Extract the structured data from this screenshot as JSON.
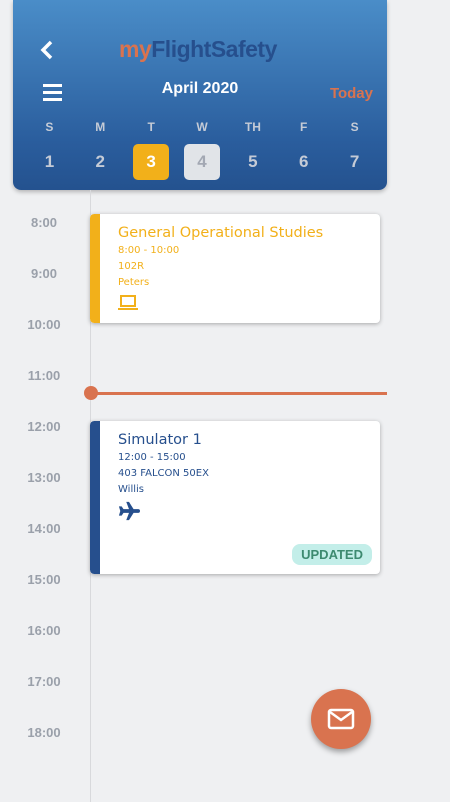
{
  "header": {
    "logo_my": "my",
    "logo_brand": "FlightSafety",
    "month": "April 2020",
    "today_label": "Today",
    "weekdays": [
      "S",
      "M",
      "T",
      "W",
      "TH",
      "F",
      "S"
    ],
    "days": [
      "1",
      "2",
      "3",
      "4",
      "5",
      "6",
      "7"
    ],
    "selected_day": "3"
  },
  "hours": [
    "8:00",
    "9:00",
    "10:00",
    "11:00",
    "12:00",
    "13:00",
    "14:00",
    "15:00",
    "16:00",
    "17:00",
    "18:00"
  ],
  "events": [
    {
      "title": "General Operational Studies",
      "time": "8:00  - 10:00",
      "room": "102R",
      "instructor": "Peters",
      "icon": "laptop-icon",
      "color": "#f2b01a"
    },
    {
      "title": "Simulator 1",
      "time": "12:00 - 15:00",
      "room": "403 FALCON 50EX",
      "instructor": "Willis",
      "icon": "airplane-icon",
      "color": "#264f8d",
      "badge": "UPDATED"
    }
  ],
  "colors": {
    "accent": "#d9734f",
    "brand": "#264f8d",
    "selected": "#f2b01a"
  }
}
